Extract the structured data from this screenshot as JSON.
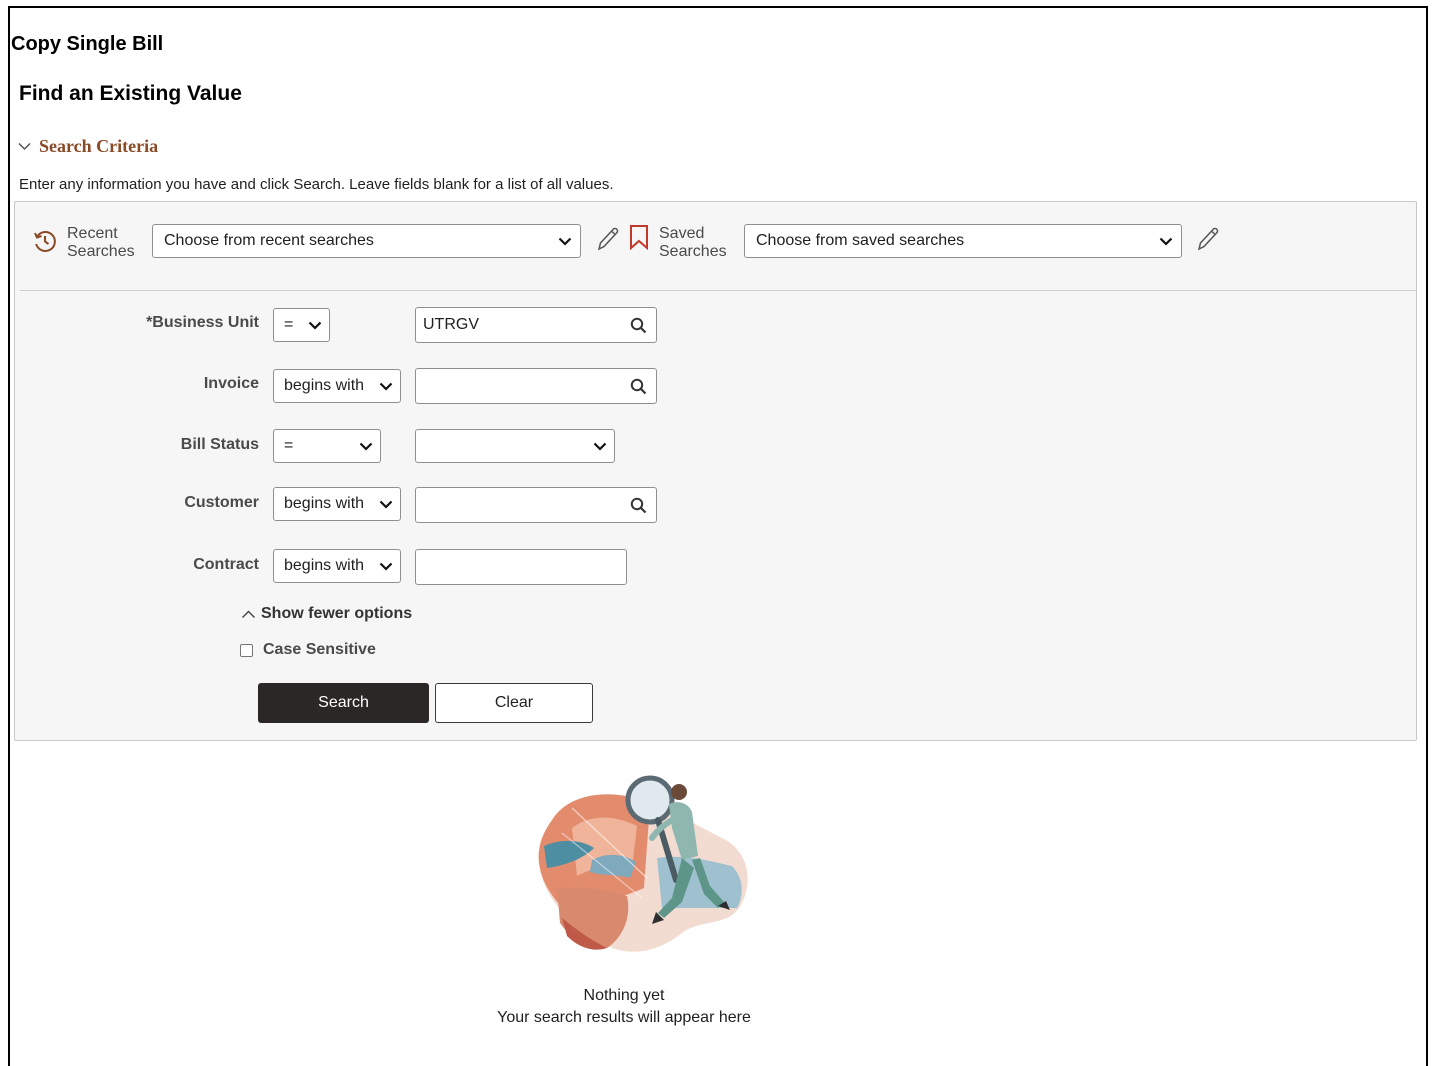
{
  "page": {
    "title": "Copy Single Bill",
    "subtitle": "Find an Existing Value"
  },
  "criteria": {
    "toggle_label": "Search Criteria",
    "instructions": "Enter any information you have and click Search. Leave fields blank for a list of all values."
  },
  "saved_searches": {
    "recent_label_1": "Recent",
    "recent_label_2": "Searches",
    "recent_value": "Choose from recent searches",
    "saved_label_1": "Saved",
    "saved_label_2": "Searches",
    "saved_value": "Choose from saved searches"
  },
  "fields": {
    "business_unit": {
      "label": "*Business Unit",
      "operator": "=",
      "value": "UTRGV"
    },
    "invoice": {
      "label": "Invoice",
      "operator": "begins with",
      "value": ""
    },
    "bill_status": {
      "label": "Bill Status",
      "operator": "=",
      "value": ""
    },
    "customer": {
      "label": "Customer",
      "operator": "begins with",
      "value": ""
    },
    "contract": {
      "label": "Contract",
      "operator": "begins with",
      "value": ""
    }
  },
  "options": {
    "fewer_label": "Show fewer options",
    "case_sensitive_label": "Case Sensitive",
    "case_sensitive_checked": false
  },
  "buttons": {
    "search": "Search",
    "clear": "Clear"
  },
  "empty_state": {
    "title": "Nothing yet",
    "message": "Your search results will appear here"
  },
  "colors": {
    "accent": "#8a4a26",
    "bookmark": "#c0392b",
    "primary_button": "#2b2726",
    "panel_bg": "#f6f6f6"
  },
  "icons": {
    "criteria_toggle": "chevron-down-icon",
    "recent": "history-icon",
    "saved": "bookmark-icon",
    "edit": "pencil-icon",
    "lookup": "search-icon",
    "select": "chevron-down-icon",
    "fewer": "chevron-up-icon"
  }
}
